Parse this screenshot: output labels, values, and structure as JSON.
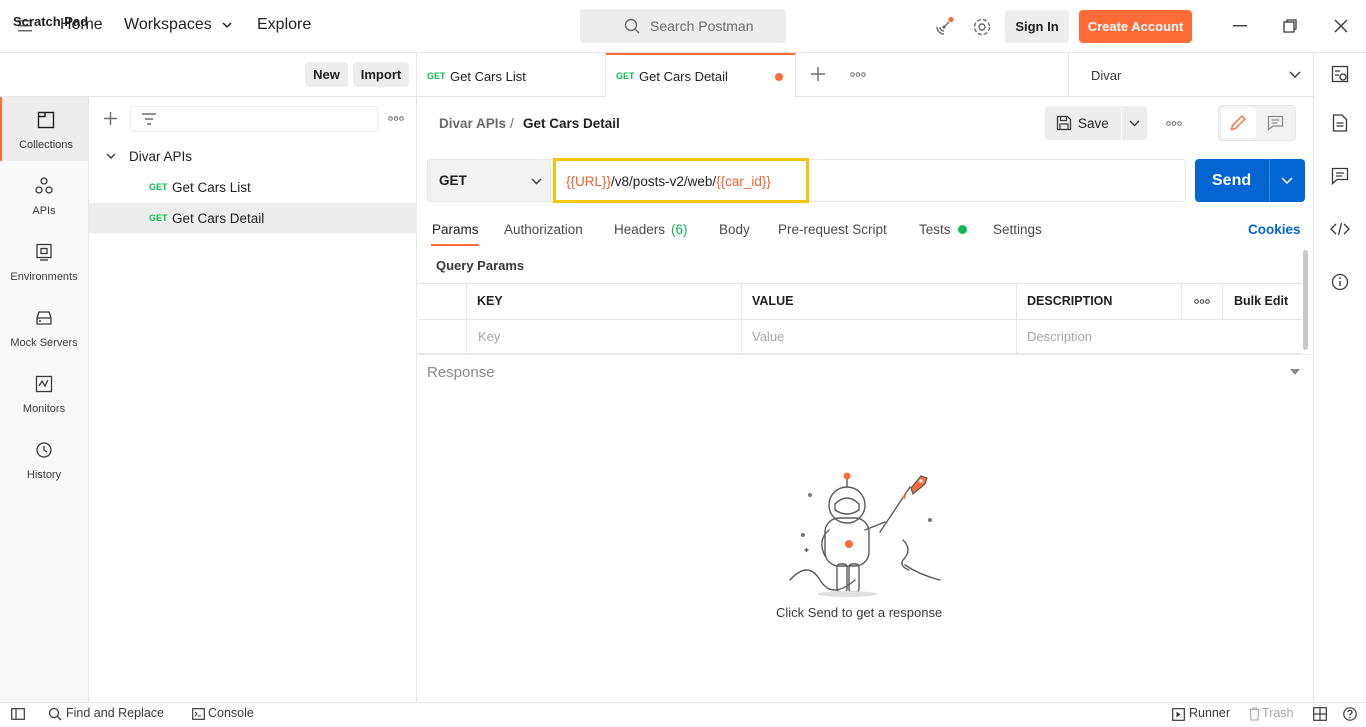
{
  "topbar": {
    "nav": [
      "Home",
      "Workspaces",
      "Explore"
    ],
    "search_placeholder": "Search Postman",
    "signin_label": "Sign In",
    "create_account_label": "Create Account",
    "accent_color": "#ff6c37"
  },
  "scratch_pad": {
    "title": "Scratch Pad",
    "new_label": "New",
    "import_label": "Import"
  },
  "rail": {
    "items": [
      {
        "label": "Collections",
        "icon": "collections-icon"
      },
      {
        "label": "APIs",
        "icon": "apis-icon"
      },
      {
        "label": "Environments",
        "icon": "environments-icon"
      },
      {
        "label": "Mock Servers",
        "icon": "mock-servers-icon"
      },
      {
        "label": "Monitors",
        "icon": "monitors-icon"
      },
      {
        "label": "History",
        "icon": "history-icon"
      }
    ]
  },
  "tree": {
    "collection_name": "Divar APIs",
    "requests": [
      {
        "method": "GET",
        "name": "Get Cars List"
      },
      {
        "method": "GET",
        "name": "Get Cars Detail"
      }
    ]
  },
  "tabs": [
    {
      "method": "GET",
      "name": "Get Cars List"
    },
    {
      "method": "GET",
      "name": "Get Cars Detail"
    }
  ],
  "environment": "Divar",
  "request": {
    "breadcrumb_collection": "Divar APIs",
    "breadcrumb_sep": "/",
    "breadcrumb_request": "Get Cars Detail",
    "save_label": "Save",
    "method": "GET",
    "url_parts": {
      "var1": "{{URL}}",
      "path": "/v8/posts-v2/web/",
      "var2": "{{car_id}}"
    },
    "send_label": "Send",
    "tabs": {
      "params": "Params",
      "authorization": "Authorization",
      "headers": "Headers",
      "headers_count": "(6)",
      "body": "Body",
      "prerequest": "Pre-request Script",
      "tests": "Tests",
      "settings": "Settings"
    },
    "cookies_label": "Cookies",
    "query_params_title": "Query Params",
    "table": {
      "headers": [
        "KEY",
        "VALUE",
        "DESCRIPTION"
      ],
      "bulk_edit": "Bulk Edit",
      "placeholders": [
        "Key",
        "Value",
        "Description"
      ]
    }
  },
  "response": {
    "title": "Response",
    "hint": "Click Send to get a response"
  },
  "statusbar": {
    "find_replace": "Find and Replace",
    "console": "Console",
    "runner": "Runner",
    "trash": "Trash"
  }
}
